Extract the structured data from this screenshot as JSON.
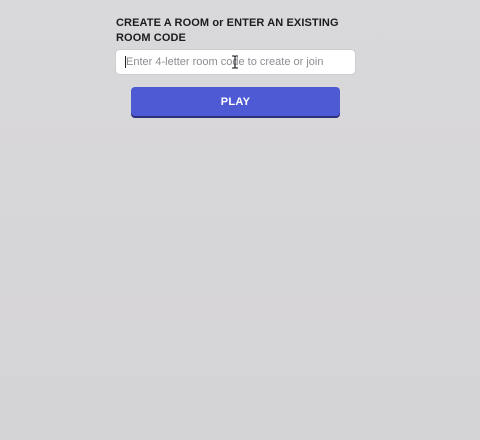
{
  "form": {
    "heading": "CREATE A ROOM or ENTER AN EXISTING ROOM CODE",
    "room_code_input": {
      "value": "",
      "placeholder": "Enter 4-letter room code to create or join"
    },
    "play_label": "PLAY"
  },
  "colors": {
    "background": "#d7d6d8",
    "button": "#4e5ad4",
    "button_shadow": "#2c2f7a",
    "input_background": "#ffffff"
  },
  "icons": {
    "pointer": "text-cursor-icon"
  }
}
